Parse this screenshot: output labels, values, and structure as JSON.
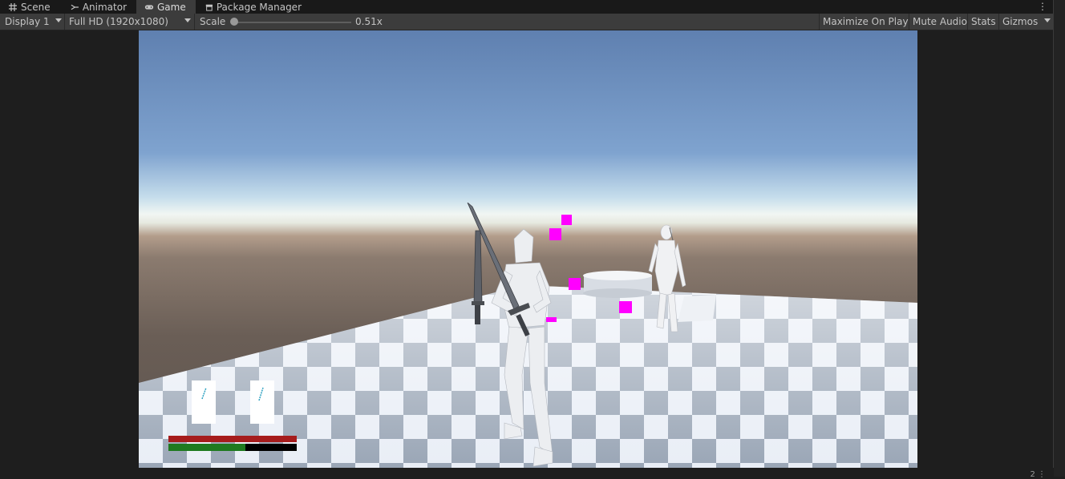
{
  "tabs": [
    {
      "label": "Scene",
      "icon": "grid-icon"
    },
    {
      "label": "Animator",
      "icon": "animator-icon"
    },
    {
      "label": "Game",
      "icon": "gamepad-icon"
    },
    {
      "label": "Package Manager",
      "icon": "package-icon"
    }
  ],
  "toolbar": {
    "display": "Display 1",
    "resolution": "Full HD (1920x1080)",
    "scale_label": "Scale",
    "scale_value": "0.51x",
    "maximize": "Maximize On Play",
    "mute": "Mute Audio",
    "stats": "Stats",
    "gizmos": "Gizmos"
  },
  "hud": {
    "health_fraction": 1.0,
    "stamina_fraction": 0.6
  },
  "footer": {
    "count": "2"
  },
  "colors": {
    "accent_magenta": "#ff00ff",
    "health_red": "#a61c1c",
    "stamina_green": "#1f7a1f"
  }
}
